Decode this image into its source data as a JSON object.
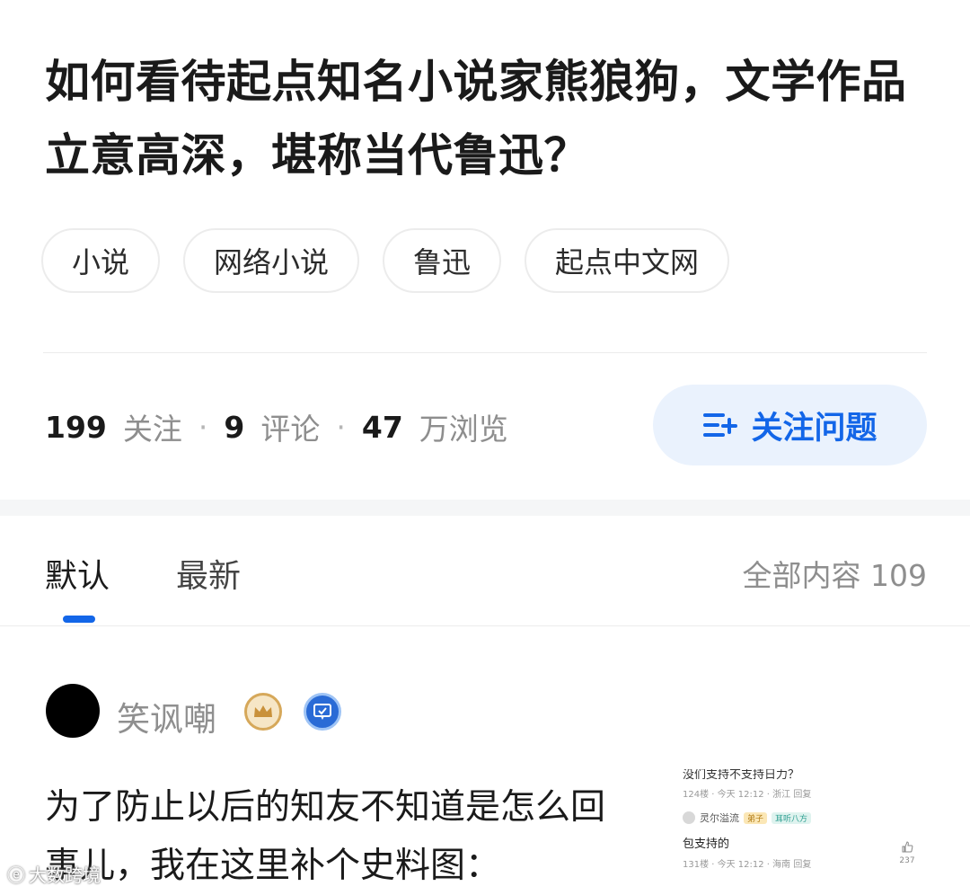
{
  "question": {
    "title": "如何看待起点知名小说家熊狼狗，文学作品立意高深，堪称当代鲁迅？",
    "tags": [
      "小说",
      "网络小说",
      "鲁迅",
      "起点中文网"
    ]
  },
  "stats": {
    "followers_count": "199",
    "followers_label": "关注",
    "comments_count": "9",
    "comments_label": "评论",
    "views_count": "47",
    "views_label": "万浏览",
    "separator": "·"
  },
  "follow_button": {
    "label": "关注问题",
    "icon": "add-list-icon",
    "color": "#1366e8",
    "bg": "#eaf2fd"
  },
  "tabs": {
    "items": [
      "默认",
      "最新"
    ],
    "active": "默认",
    "total": "全部内容 109"
  },
  "answer": {
    "author": "笑讽嘲",
    "badges": [
      "crown-badge-icon",
      "certified-badge-icon"
    ],
    "text": "为了防止以后的知友不知道是怎么回事儿，我在这里补个史料图："
  },
  "screenshot_comments": {
    "cut_text": "没们支持不支持日力？",
    "first_meta": "124楼 · 今天 12:12 · 浙江  回复",
    "second_user": "灵尔溢流",
    "second_badges": [
      "弟子",
      "耳听八方"
    ],
    "second_body": "包支持的",
    "second_meta": "131楼 · 今天 12:12 · 海南  回复",
    "like_count": "237"
  },
  "watermark": "大数跨境",
  "colors": {
    "accent": "#1366e8"
  }
}
